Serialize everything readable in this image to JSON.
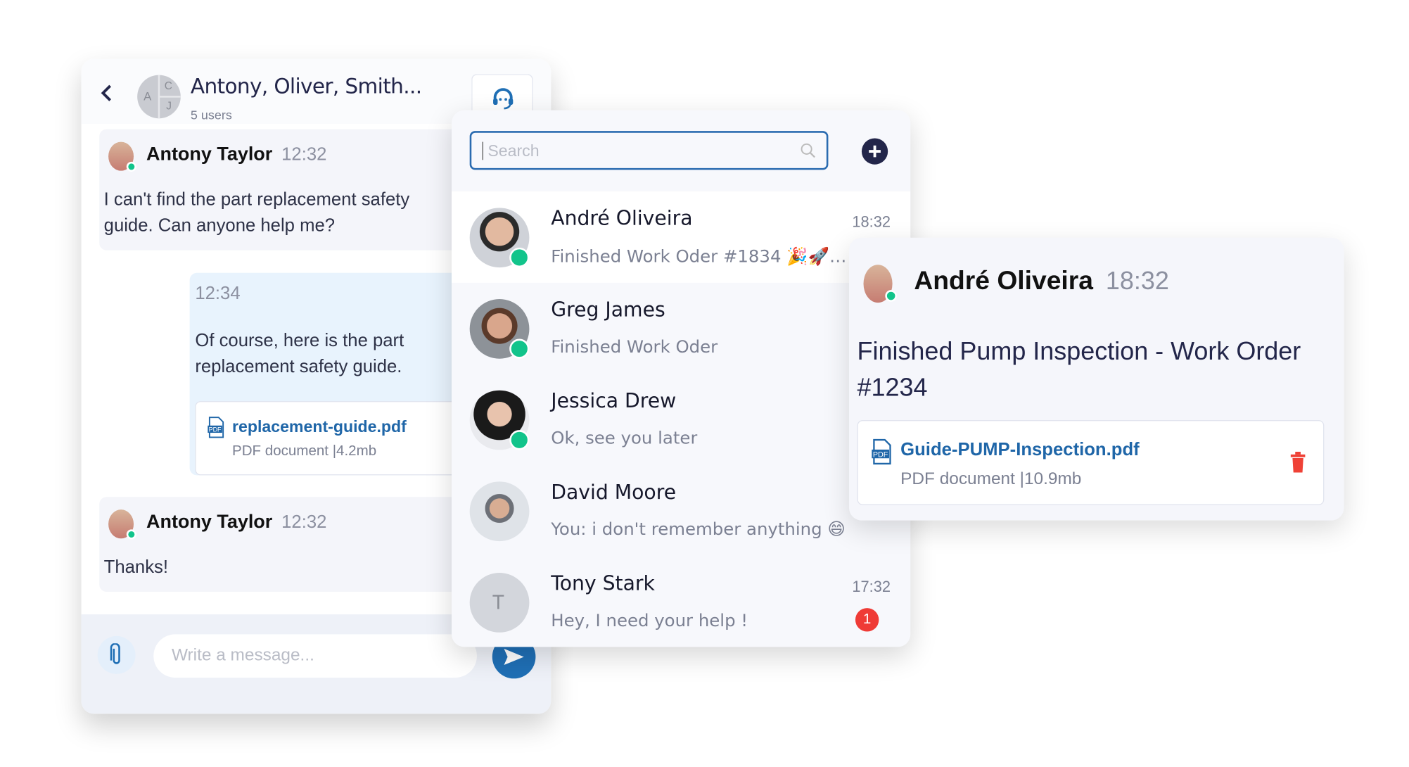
{
  "chat": {
    "title": "Antony, Oliver, Smith...",
    "subtitle": "5 users",
    "group_initials": [
      "A",
      "C",
      "J"
    ],
    "messages": [
      {
        "author": "Antony Taylor",
        "time": "12:32",
        "text": "I can't find the part replacement safety guide. Can anyone help me?"
      },
      {
        "time": "12:34",
        "text": "Of course, here is the part replacement safety guide.",
        "attachment": {
          "name": "replacement-guide.pdf",
          "meta": "PDF document |4.2mb"
        }
      },
      {
        "author": "Antony Taylor",
        "time": "12:32",
        "text": "Thanks!"
      }
    ],
    "input_placeholder": "Write a message..."
  },
  "list": {
    "search_placeholder": "Search",
    "items": [
      {
        "name": "André Oliveira",
        "preview": "Finished Work Oder #1834 🎉🚀🎉...",
        "time": "18:32",
        "online": true
      },
      {
        "name": "Greg James",
        "preview": "Finished Work Oder",
        "time": "",
        "online": true
      },
      {
        "name": "Jessica Drew",
        "preview": "Ok, see you later",
        "time": "",
        "online": true
      },
      {
        "name": "David Moore",
        "preview": "You: i don't remember anything 😄",
        "time": "",
        "online": false
      },
      {
        "name": "Tony Stark",
        "initial": "T",
        "preview": "Hey, I need your help !",
        "time": "17:32",
        "unread": "1"
      }
    ]
  },
  "detail": {
    "author": "André Oliveira",
    "time": "18:32",
    "text": "Finished Pump Inspection - Work Order #1234",
    "attachment": {
      "name": "Guide-PUMP-Inspection.pdf",
      "meta": "PDF document |10.9mb"
    }
  },
  "colors": {
    "accent": "#1f6fb5",
    "online": "#12c48b",
    "unread": "#ef3b36",
    "navy": "#23264a",
    "delete": "#ef4136"
  }
}
